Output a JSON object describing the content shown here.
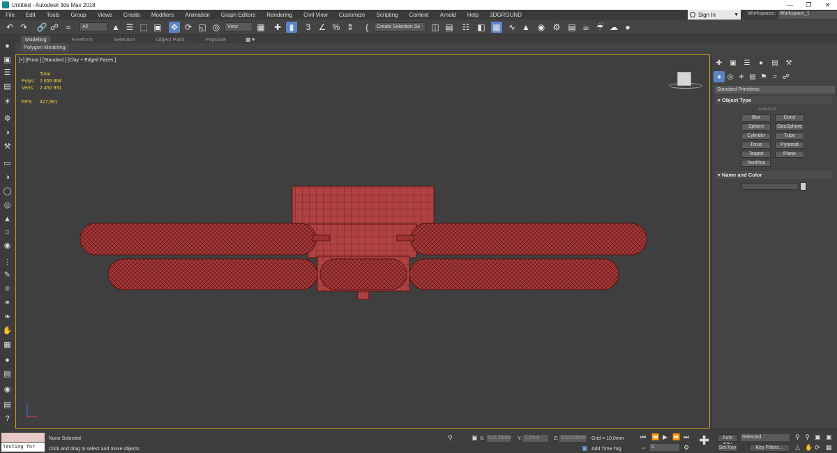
{
  "window": {
    "title": "Untitled - Autodesk 3ds Max 2018"
  },
  "menu": [
    "File",
    "Edit",
    "Tools",
    "Group",
    "Views",
    "Create",
    "Modifiers",
    "Animation",
    "Graph Editors",
    "Rendering",
    "Civil View",
    "Customize",
    "Scripting",
    "Content",
    "Arnold",
    "Help",
    "3DGROUND"
  ],
  "account": {
    "signin": "Sign In",
    "workspaces_label": "Workspaces:",
    "workspace": "Workspace_1"
  },
  "toolbar": {
    "selection_filter": "All",
    "ref_coord": "View",
    "named_selection": "Create Selection Se"
  },
  "ribbon": {
    "tabs": [
      "Modeling",
      "Freeform",
      "Selection",
      "Object Paint",
      "Populate"
    ],
    "subtab": "Polygon Modeling"
  },
  "viewport": {
    "label": "[+] [Front ] [Standard ] [Clay + Edged Faces ]",
    "stats": {
      "header": "Total",
      "polys_label": "Polys:",
      "polys": "2 656 864",
      "verts_label": "Verts:",
      "verts": "2 450 931",
      "fps_label": "FPS:",
      "fps": "427,991"
    },
    "object_color": "#a83a3a"
  },
  "command_panel": {
    "category": "Standard Primitives",
    "object_type": {
      "title": "Object Type",
      "autogrid": "AutoGrid",
      "buttons": [
        "Box",
        "Cone",
        "Sphere",
        "GeoSphere",
        "Cylinder",
        "Tube",
        "Torus",
        "Pyramid",
        "Teapot",
        "Plane",
        "TextPlus"
      ]
    },
    "name_color": {
      "title": "Name and Color"
    }
  },
  "status": {
    "maxscript_text": "Testing for",
    "selection": "None Selected",
    "prompt": "Click and drag to select and move objects",
    "x_label": "X:",
    "x_value": "512,39mm",
    "y_label": "Y:",
    "y_value": "0,0mm",
    "z_label": "Z:",
    "z_value": "409,536mm",
    "grid": "Grid = 10,0mm",
    "add_time_tag": "Add Time Tag",
    "auto_key": "Auto Key",
    "set_key": "Set Key",
    "key_mode": "Selected",
    "key_filters": "Key Filters...",
    "frame": "0"
  },
  "colors": {
    "accent": "#5b86c4",
    "viewport_border": "#c99a1a",
    "stats": "#f2d23c"
  }
}
